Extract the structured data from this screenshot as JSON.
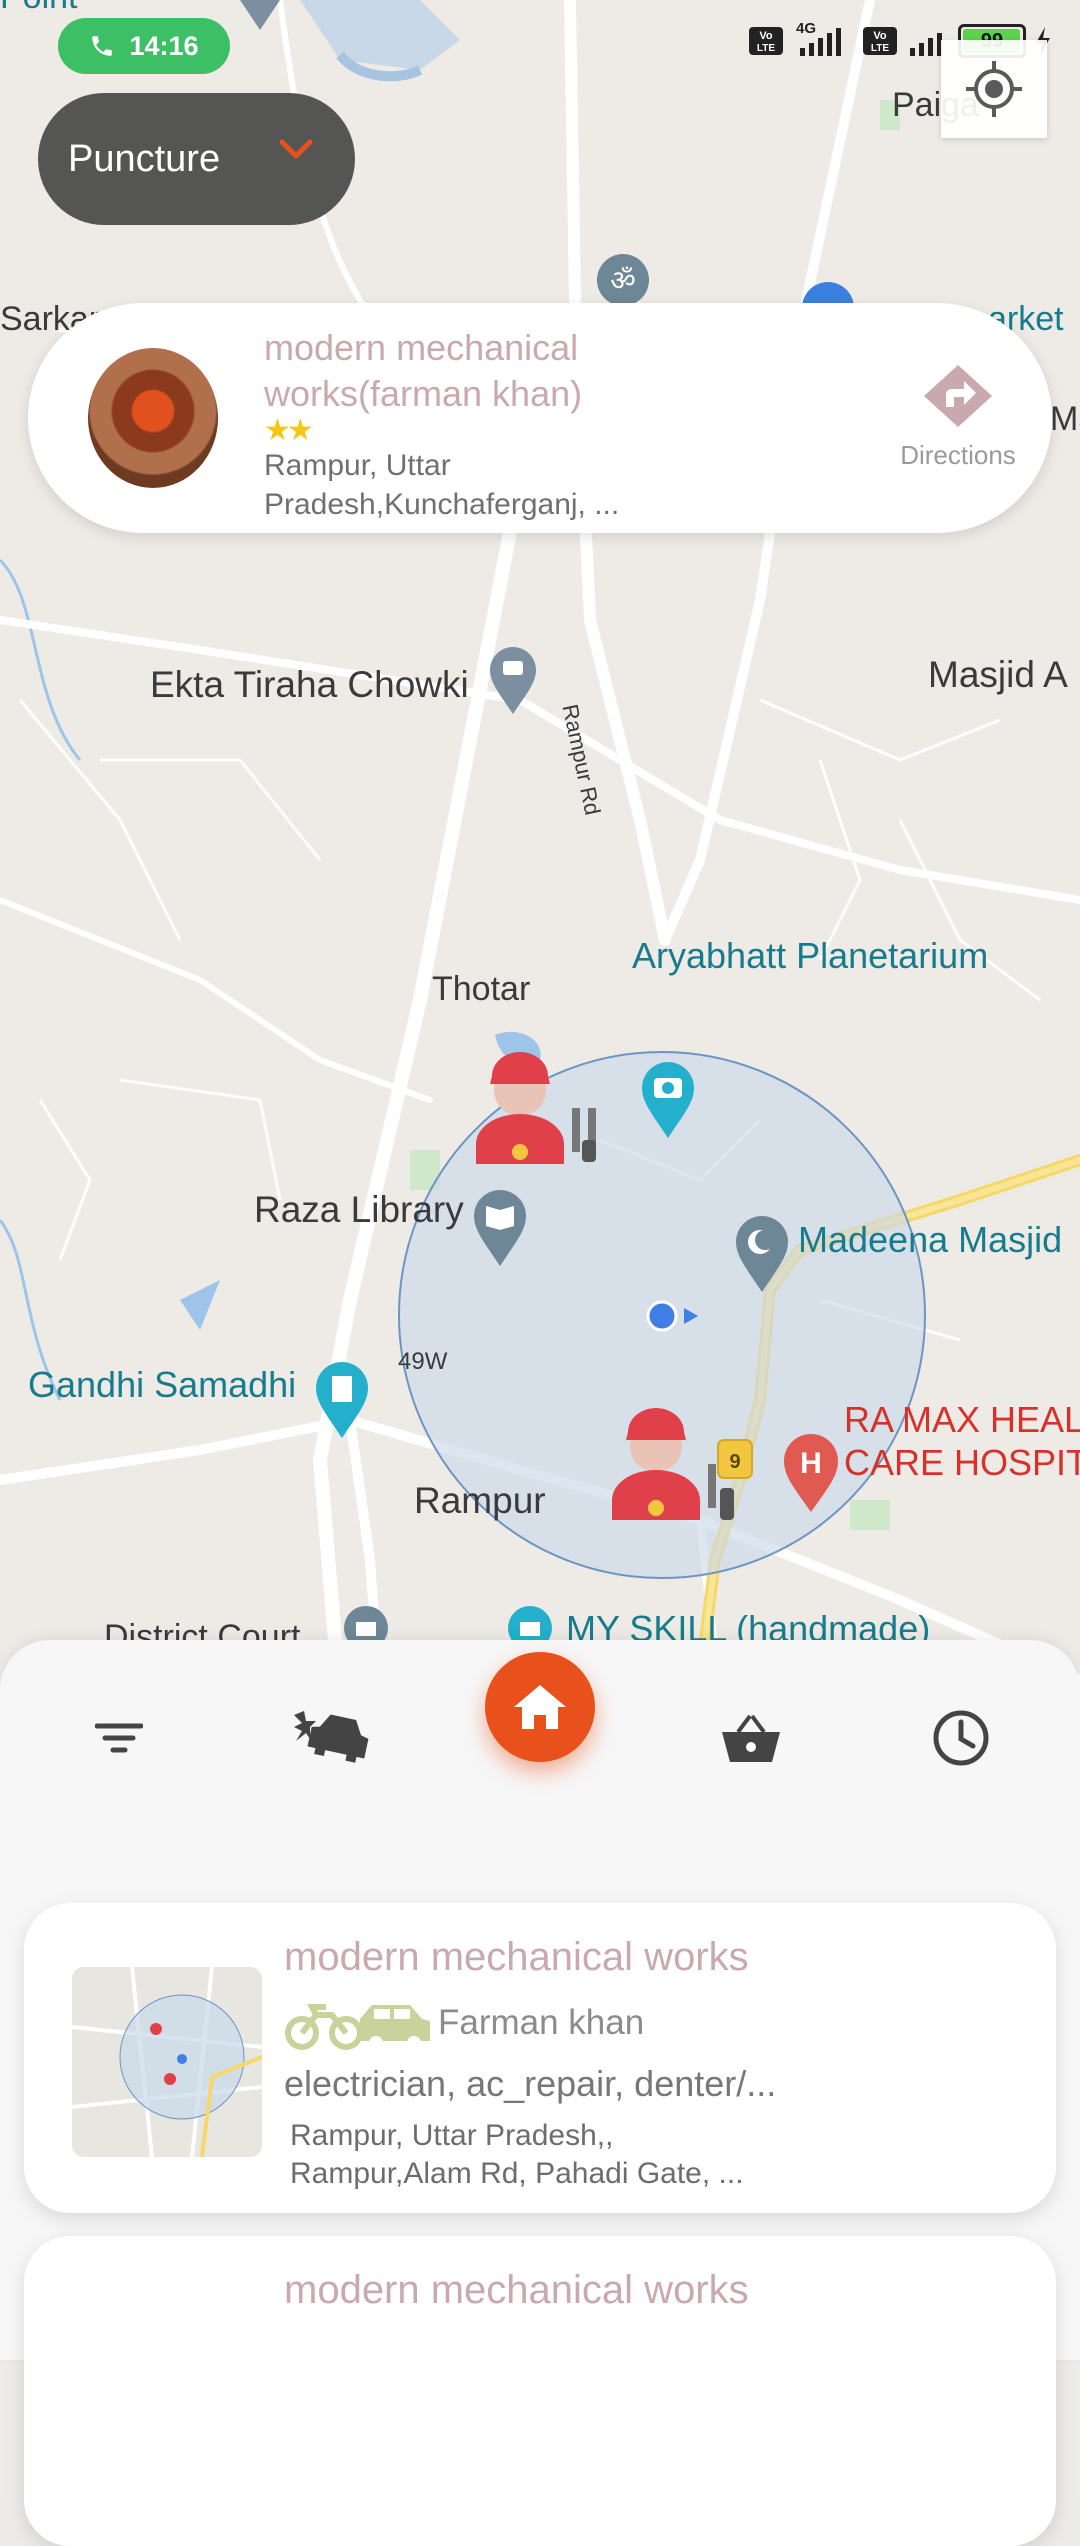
{
  "status_bar": {
    "call_time": "14:16",
    "network_1": "4G",
    "battery_level": "99",
    "battery_percent": 99
  },
  "filter_dropdown": {
    "selected": "Puncture"
  },
  "map_labels": {
    "paiga": "Paiga",
    "sarkar": "Sarkar",
    "market": "arket",
    "ma": "Ma",
    "ekta_tiraha": "Ekta Tiraha Chowki",
    "rampur_rd": "Rampur Rd",
    "masjid_a": "Masjid A",
    "aryabhatt": "Aryabhatt Planetarium",
    "thotar": "Thotar",
    "raza_library": "Raza Library",
    "madeena_masjid": "Madeena Masjid",
    "route_49w": "49W",
    "gandhi_samadhi": "Gandhi Samadhi",
    "ra_max": "RA MAX HEAL\nCARE HOSPIT.",
    "rampur": "Rampur",
    "district_court": "District Court",
    "my_skill": "MY SKILL (handmade)",
    "point_top": "Point"
  },
  "shop_card": {
    "name": "modern mechanical works(farman khan)",
    "stars": "★★",
    "address": " Rampur, Uttar\nPradesh,Kunchaferganj, ...",
    "directions_label": "Directions"
  },
  "bottom_nav": {
    "items": [
      "filter-icon",
      "car-crash-icon",
      "home-icon",
      "basket-icon",
      "clock-icon"
    ]
  },
  "listings": [
    {
      "title": "modern mechanical works",
      "owner": "Farman khan",
      "services": "electrician, ac_repair, denter/...",
      "address": " Rampur, Uttar Pradesh,,\nRampur,Alam Rd, Pahadi Gate, ..."
    },
    {
      "title": "modern mechanical works"
    }
  ],
  "colors": {
    "accent": "#e9511c",
    "call_green": "#3dbf65",
    "title_pink": "#c9a9ad",
    "map_teal": "#167b8c",
    "map_red": "#d8312b"
  }
}
